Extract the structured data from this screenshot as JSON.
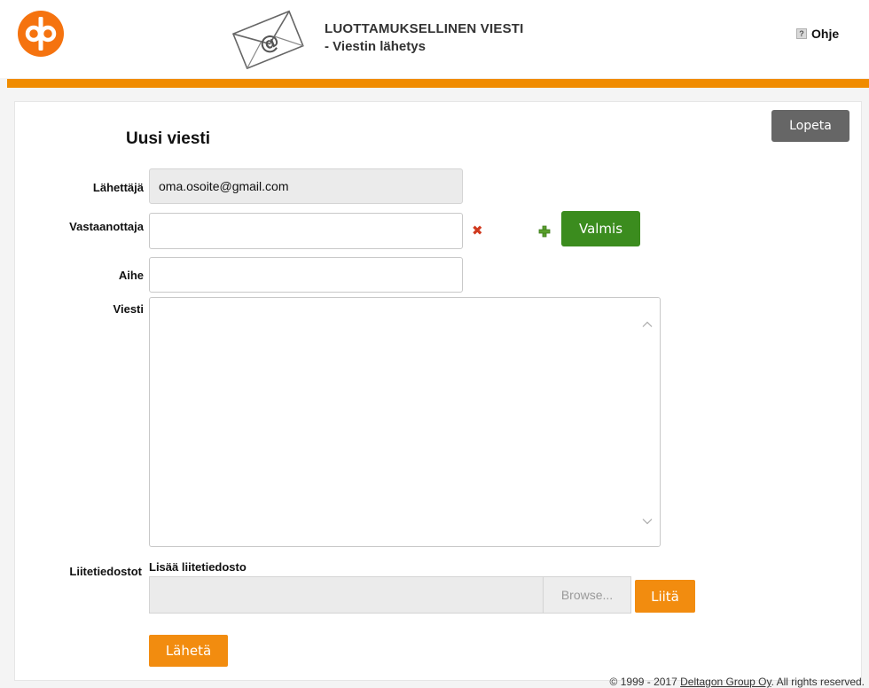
{
  "header": {
    "title": "LUOTTAMUKSELLINEN VIESTI",
    "subtitle": "- Viestin lähetys",
    "help_label": "Ohje",
    "help_icon_glyph": "?"
  },
  "colors": {
    "brand_orange": "#f08c00",
    "done_green": "#3b8c1e",
    "quit_gray": "#666666"
  },
  "actions": {
    "quit_label": "Lopeta",
    "done_label": "Valmis",
    "remove_recipient_glyph": "✖",
    "attach_label": "Liitä",
    "send_label": "Lähetä"
  },
  "form": {
    "page_title": "Uusi viesti",
    "sender": {
      "label": "Lähettäjä",
      "value": "oma.osoite@gmail.com"
    },
    "recipient": {
      "label": "Vastaanottaja",
      "value": ""
    },
    "subject": {
      "label": "Aihe",
      "value": ""
    },
    "message": {
      "label": "Viesti",
      "value": ""
    },
    "attachments": {
      "label": "Liitetiedostot",
      "add_label": "Lisää liitetiedosto",
      "browse_label": "Browse..."
    }
  },
  "footer": {
    "prefix": "© 1999 - 2017 ",
    "company_link": "Deltagon Group Oy",
    "suffix": ". All rights reserved."
  }
}
